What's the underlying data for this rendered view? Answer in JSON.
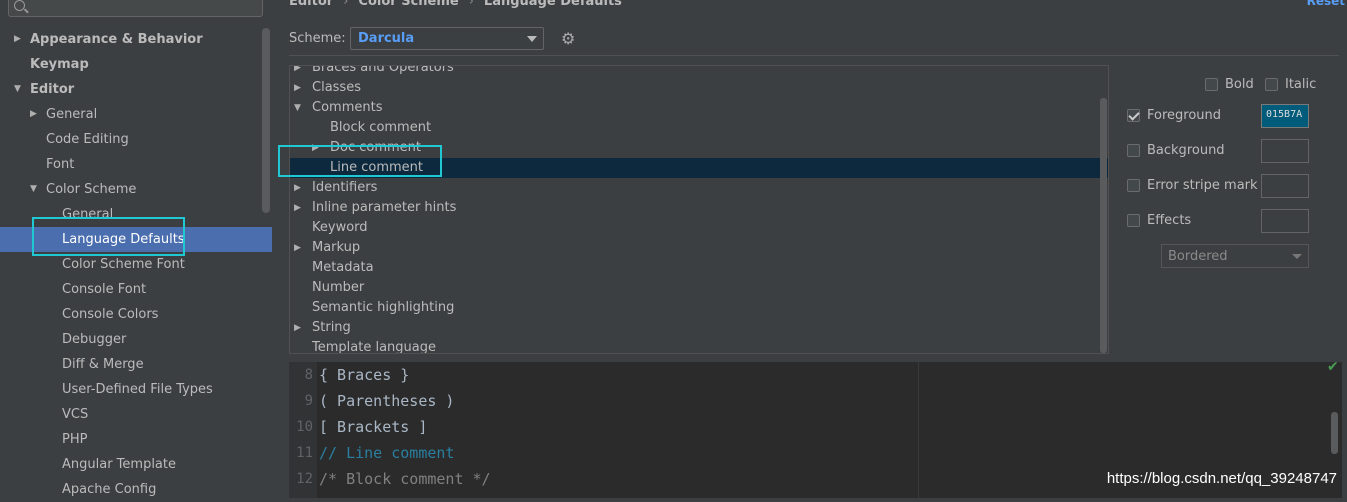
{
  "search": {
    "placeholder": ""
  },
  "sidebar": {
    "items": [
      {
        "label": "Appearance & Behavior",
        "indent": 0,
        "arrow": "right",
        "bold": true
      },
      {
        "label": "Keymap",
        "indent": 0,
        "arrow": "",
        "bold": true
      },
      {
        "label": "Editor",
        "indent": 0,
        "arrow": "down",
        "bold": true
      },
      {
        "label": "General",
        "indent": 1,
        "arrow": "right"
      },
      {
        "label": "Code Editing",
        "indent": 1,
        "arrow": ""
      },
      {
        "label": "Font",
        "indent": 1,
        "arrow": ""
      },
      {
        "label": "Color Scheme",
        "indent": 1,
        "arrow": "down"
      },
      {
        "label": "General",
        "indent": 2,
        "arrow": ""
      },
      {
        "label": "Language Defaults",
        "indent": 2,
        "arrow": "",
        "selected": true
      },
      {
        "label": "Color Scheme Font",
        "indent": 2,
        "arrow": ""
      },
      {
        "label": "Console Font",
        "indent": 2,
        "arrow": ""
      },
      {
        "label": "Console Colors",
        "indent": 2,
        "arrow": ""
      },
      {
        "label": "Debugger",
        "indent": 2,
        "arrow": ""
      },
      {
        "label": "Diff & Merge",
        "indent": 2,
        "arrow": ""
      },
      {
        "label": "User-Defined File Types",
        "indent": 2,
        "arrow": ""
      },
      {
        "label": "VCS",
        "indent": 2,
        "arrow": ""
      },
      {
        "label": "PHP",
        "indent": 2,
        "arrow": ""
      },
      {
        "label": "Angular Template",
        "indent": 2,
        "arrow": ""
      },
      {
        "label": "Apache Config",
        "indent": 2,
        "arrow": ""
      }
    ]
  },
  "breadcrumb": {
    "part1": "Editor",
    "sep": "›",
    "part2": "Color Scheme",
    "part3": "Language Defaults"
  },
  "reset_label": "Reset",
  "scheme": {
    "label": "Scheme:",
    "value": "Darcula"
  },
  "elements": [
    {
      "label": "Braces and Operators",
      "indent": 0,
      "arrow": "right"
    },
    {
      "label": "Classes",
      "indent": 0,
      "arrow": "right"
    },
    {
      "label": "Comments",
      "indent": 0,
      "arrow": "down"
    },
    {
      "label": "Block comment",
      "indent": 1,
      "arrow": ""
    },
    {
      "label": "Doc comment",
      "indent": 1,
      "arrow": "right"
    },
    {
      "label": "Line comment",
      "indent": 1,
      "arrow": "",
      "selected": true
    },
    {
      "label": "Identifiers",
      "indent": 0,
      "arrow": "right"
    },
    {
      "label": "Inline parameter hints",
      "indent": 0,
      "arrow": "right"
    },
    {
      "label": "Keyword",
      "indent": 0,
      "arrow": ""
    },
    {
      "label": "Markup",
      "indent": 0,
      "arrow": "right"
    },
    {
      "label": "Metadata",
      "indent": 0,
      "arrow": ""
    },
    {
      "label": "Number",
      "indent": 0,
      "arrow": ""
    },
    {
      "label": "Semantic highlighting",
      "indent": 0,
      "arrow": ""
    },
    {
      "label": "String",
      "indent": 0,
      "arrow": "right"
    },
    {
      "label": "Template language",
      "indent": 0,
      "arrow": ""
    }
  ],
  "options": {
    "bold": "Bold",
    "italic": "Italic",
    "foreground": "Foreground",
    "foreground_hex": "015B7A",
    "background": "Background",
    "error_stripe": "Error stripe mark",
    "effects": "Effects",
    "effect_type": "Bordered"
  },
  "preview": {
    "lines": [
      {
        "num": "8",
        "text": "{ Braces }",
        "kind": "code"
      },
      {
        "num": "9",
        "text": "( Parentheses )",
        "kind": "code"
      },
      {
        "num": "10",
        "text": "[ Brackets ]",
        "kind": "code"
      },
      {
        "num": "11",
        "text": "// Line comment",
        "kind": "linecomment"
      },
      {
        "num": "12",
        "text": "/* Block comment */",
        "kind": "blockcomment"
      }
    ]
  },
  "watermark": "https://blog.csdn.net/qq_39248747",
  "colors": {
    "accent": "#589df6",
    "selected_row": "#4b6eaf",
    "highlight_box": "#1fc8d2",
    "foreground_swatch": "#015b7a"
  }
}
